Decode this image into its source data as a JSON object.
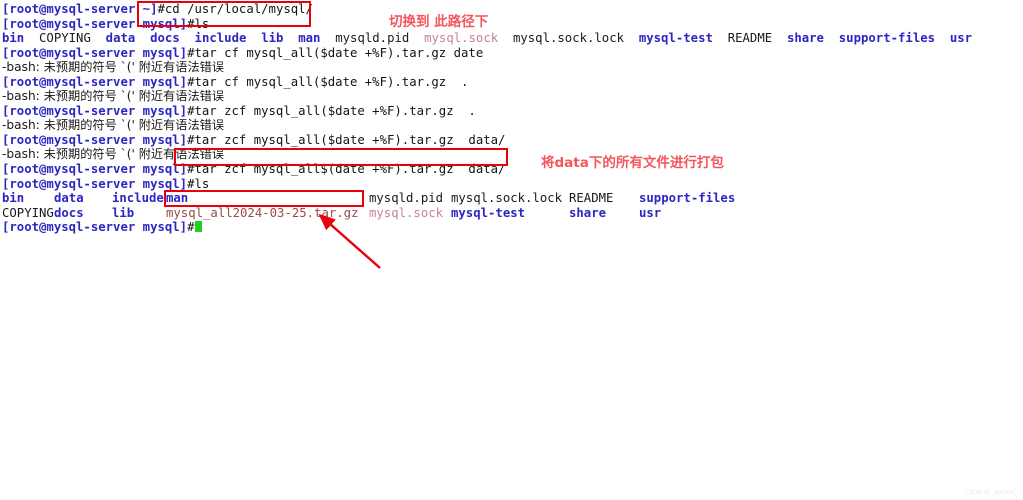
{
  "terminal": {
    "hostname_prompt_short": "[root@mysql-server ~]",
    "hostname_prompt_mysql": "[root@mysql-server mysql]",
    "bash_error": "-bash: 未预期的符号 `(' 附近有语法错误",
    "lines": [
      {
        "type": "command",
        "prompt": "[root@mysql-server ~]",
        "command": "#cd /usr/local/mysql/"
      },
      {
        "type": "command",
        "prompt": "[root@mysql-server mysql]",
        "command": "#ls"
      },
      {
        "type": "ls-row",
        "row": 2
      },
      {
        "type": "command",
        "prompt": "[root@mysql-server mysql]",
        "command": "#tar cf mysql_all($date +%F).tar.gz date"
      },
      {
        "type": "error",
        "text": "-bash: 未预期的符号 `(' 附近有语法错误"
      },
      {
        "type": "command",
        "prompt": "[root@mysql-server mysql]",
        "command": "#tar cf mysql_all($date +%F).tar.gz  ."
      },
      {
        "type": "error",
        "text": "-bash: 未预期的符号 `(' 附近有语法错误"
      },
      {
        "type": "command",
        "prompt": "[root@mysql-server mysql]",
        "command": "#tar zcf mysql_all($date +%F).tar.gz  ."
      },
      {
        "type": "error",
        "text": "-bash: 未预期的符号 `(' 附近有语法错误"
      },
      {
        "type": "command",
        "prompt": "[root@mysql-server mysql]",
        "command": "#tar zcf mysql_all($date +%F).tar.gz  data/"
      },
      {
        "type": "error",
        "text": "-bash: 未预期的符号 `(' 附近有语法错误"
      },
      {
        "type": "command",
        "prompt": "[root@mysql-server mysql]",
        "command": "#tar zcf mysql_all$(date +%F).tar.gz  data/"
      },
      {
        "type": "command",
        "prompt": "[root@mysql-server mysql]",
        "command": "#ls"
      },
      {
        "type": "ls-row",
        "row": 13
      },
      {
        "type": "ls-row",
        "row": 14
      },
      {
        "type": "command",
        "prompt": "[root@mysql-server mysql]",
        "command": "#",
        "cursor": true
      }
    ],
    "ls_first": {
      "entries": [
        {
          "name": "bin",
          "kind": "dir"
        },
        {
          "name": "COPYING",
          "kind": "file"
        },
        {
          "name": "data",
          "kind": "dir"
        },
        {
          "name": "docs",
          "kind": "dir"
        },
        {
          "name": "include",
          "kind": "dir"
        },
        {
          "name": "lib",
          "kind": "dir"
        },
        {
          "name": "man",
          "kind": "dir"
        },
        {
          "name": "mysqld.pid",
          "kind": "file"
        },
        {
          "name": "mysql.sock",
          "kind": "sock"
        },
        {
          "name": "mysql.sock.lock",
          "kind": "file"
        },
        {
          "name": "mysql-test",
          "kind": "dir"
        },
        {
          "name": "README",
          "kind": "file"
        },
        {
          "name": "share",
          "kind": "dir"
        },
        {
          "name": "support-files",
          "kind": "dir"
        },
        {
          "name": "usr",
          "kind": "dir"
        }
      ]
    },
    "ls_second_row1": [
      {
        "name": "bin",
        "kind": "dir",
        "col": 0
      },
      {
        "name": "data",
        "kind": "dir",
        "col": 1
      },
      {
        "name": "include",
        "kind": "dir",
        "col": 2
      },
      {
        "name": "man",
        "kind": "dir",
        "col": 3
      },
      {
        "name": "mysqld.pid",
        "kind": "file",
        "col": 4
      },
      {
        "name": "mysql.sock.lock",
        "kind": "file",
        "col": 5
      },
      {
        "name": "README",
        "kind": "file",
        "col": 6
      },
      {
        "name": "support-files",
        "kind": "dir",
        "col": 7
      }
    ],
    "ls_second_row2": [
      {
        "name": "COPYING",
        "kind": "file",
        "col": 0
      },
      {
        "name": "docs",
        "kind": "dir",
        "col": 1
      },
      {
        "name": "lib",
        "kind": "dir",
        "col": 2
      },
      {
        "name": "mysql_all2024-03-25.tar.gz",
        "kind": "arch",
        "col": 3
      },
      {
        "name": "mysql.sock",
        "kind": "sock",
        "col": 4
      },
      {
        "name": "mysql-test",
        "kind": "dir",
        "col": 5
      },
      {
        "name": "share",
        "kind": "dir",
        "col": 6
      },
      {
        "name": "usr",
        "kind": "dir",
        "col": 7
      }
    ]
  },
  "annotations": {
    "note_top": "切换到 此路径下",
    "note_bottom": "将data下的所有文件进行打包",
    "watermark": "CSDN @ _weixin_"
  },
  "colors": {
    "prompt_blue": "#2b26c4",
    "annotation_red": "#f4565c",
    "box_red": "#e8000d",
    "socket_pink": "#c97f9e",
    "archive_red": "#9c4a46",
    "cursor_green": "#1fd11f"
  }
}
